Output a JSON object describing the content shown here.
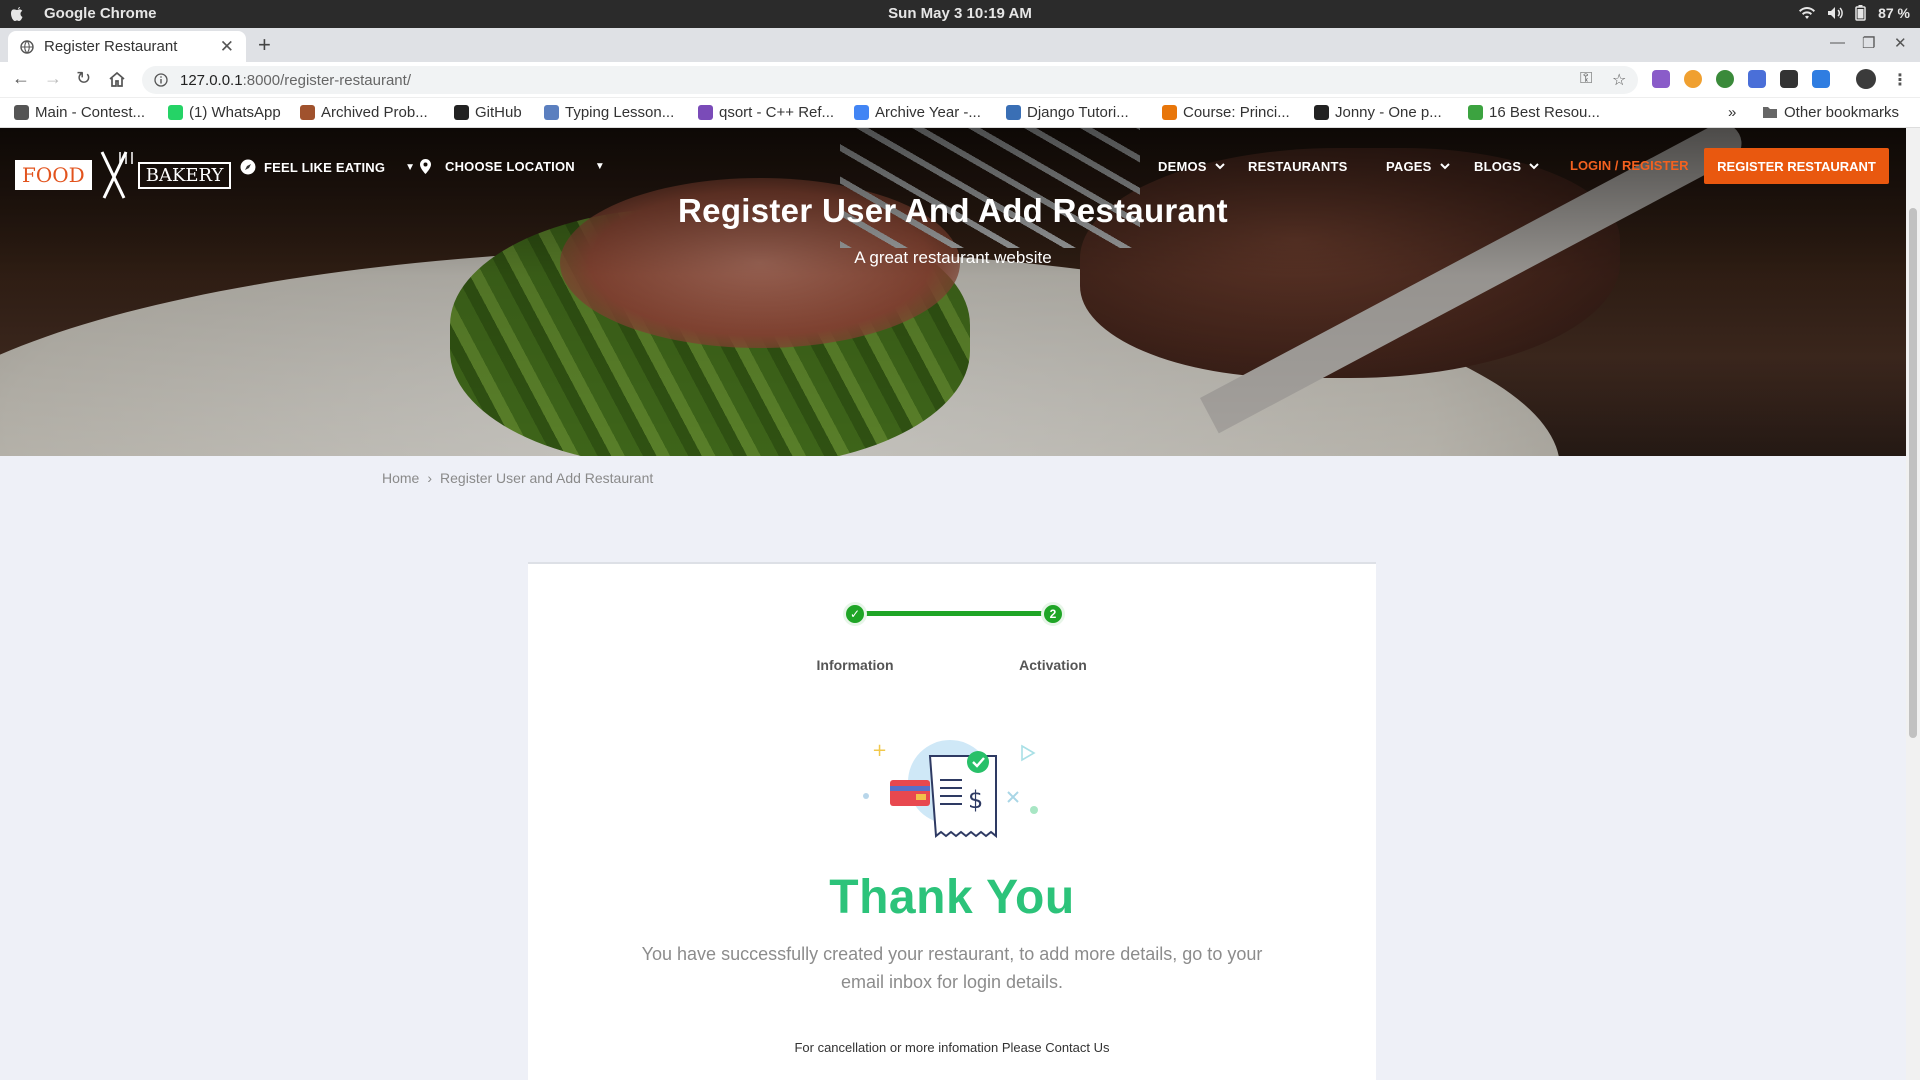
{
  "os_bar": {
    "app_name": "Google Chrome",
    "clock": "Sun May 3  10:19 AM",
    "battery": "87 %"
  },
  "browser": {
    "tab_title": "Register Restaurant",
    "url_host": "127.0.0.1",
    "url_path": ":8000/register-restaurant/",
    "bookmarks": [
      {
        "label": "Main - Contest...",
        "icon_color": "#555"
      },
      {
        "label": "(1) WhatsApp",
        "icon_color": "#25d366"
      },
      {
        "label": "Archived Prob...",
        "icon_color": "#a0522d"
      },
      {
        "label": "GitHub",
        "icon_color": "#222"
      },
      {
        "label": "Typing Lesson...",
        "icon_color": "#5b7fbf"
      },
      {
        "label": "qsort - C++ Ref...",
        "icon_color": "#7a4bb8"
      },
      {
        "label": "Archive Year -...",
        "icon_color": "#4285f4"
      },
      {
        "label": "Django Tutori...",
        "icon_color": "#3a6fb5"
      },
      {
        "label": "Course: Princi...",
        "icon_color": "#e8760a"
      },
      {
        "label": "Jonny - One p...",
        "icon_color": "#222"
      },
      {
        "label": "16 Best Resou...",
        "icon_color": "#3ca340"
      }
    ],
    "other_bookmarks": "Other bookmarks",
    "overflow": "»"
  },
  "site": {
    "logo_left": "FOOD",
    "logo_right": "BAKERY",
    "nav_feel": "FEEL LIKE EATING",
    "nav_location": "CHOOSE LOCATION",
    "nav_demos": "DEMOS",
    "nav_restaurants": "RESTAURANTS",
    "nav_pages": "PAGES",
    "nav_blogs": "BLOGS",
    "login": "LOGIN / REGISTER",
    "register_button": "REGISTER RESTAURANT",
    "accent_color": "#e9580f"
  },
  "hero": {
    "title": "Register User And Add Restaurant",
    "subtitle": "A great restaurant website"
  },
  "breadcrumb": {
    "home": "Home",
    "separator": "›",
    "current": "Register User and Add Restaurant"
  },
  "steps": [
    {
      "label": "Information",
      "marker": "✓",
      "state": "done"
    },
    {
      "label": "Activation",
      "marker": "2",
      "state": "current"
    }
  ],
  "confirmation": {
    "heading": "Thank You",
    "message": "You have successfully created your restaurant, to add more details, go to your email inbox for login details.",
    "contact_note": "For cancellation or more infomation Please Contact Us",
    "success_color": "#2cc37a"
  }
}
